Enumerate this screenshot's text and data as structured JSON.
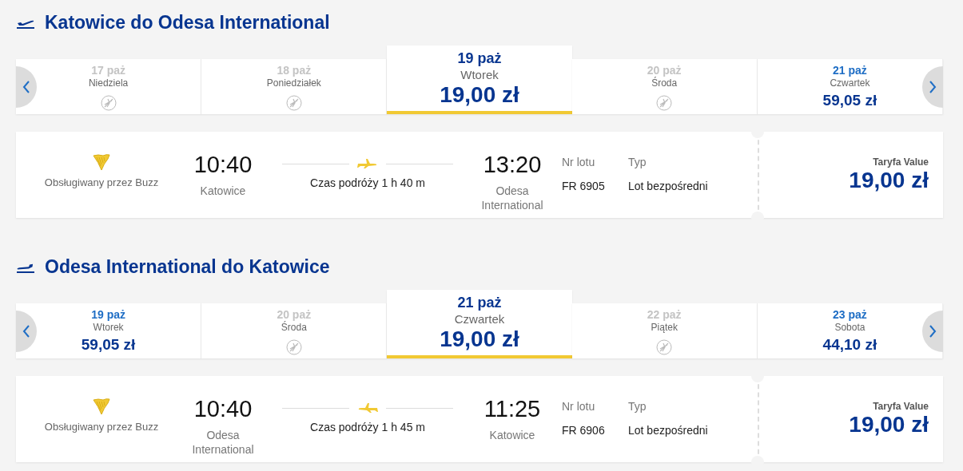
{
  "sections": [
    {
      "kind": "outbound",
      "title": "Katowice do Odesa International",
      "days": [
        {
          "date": "17 paż",
          "weekday": "Niedziela",
          "available": false,
          "selected": false
        },
        {
          "date": "18 paż",
          "weekday": "Poniedziałek",
          "available": false,
          "selected": false
        },
        {
          "date": "19 paż",
          "weekday": "Wtorek",
          "price": "19,00 zł",
          "available": true,
          "selected": true
        },
        {
          "date": "20 paż",
          "weekday": "Środa",
          "available": false,
          "selected": false
        },
        {
          "date": "21 paż",
          "weekday": "Czwartek",
          "price": "59,05 zł",
          "available": true,
          "selected": false
        }
      ],
      "flight": {
        "operator": "Obsługiwany przez Buzz",
        "departure_time": "10:40",
        "departure_city": "Katowice",
        "duration": "Czas podróży 1 h 40 m",
        "arrival_time": "13:20",
        "arrival_city": "Odesa International",
        "flight_number_label": "Nr lotu",
        "flight_number": "FR 6905",
        "type_label": "Typ",
        "type": "Lot bezpośredni",
        "fare_label": "Taryfa Value",
        "fare_price": "19,00 zł"
      }
    },
    {
      "kind": "return",
      "title": "Odesa International do Katowice",
      "days": [
        {
          "date": "19 paż",
          "weekday": "Wtorek",
          "price": "59,05 zł",
          "available": true,
          "selected": false
        },
        {
          "date": "20 paż",
          "weekday": "Środa",
          "available": false,
          "selected": false
        },
        {
          "date": "21 paż",
          "weekday": "Czwartek",
          "price": "19,00 zł",
          "available": true,
          "selected": true
        },
        {
          "date": "22 paż",
          "weekday": "Piątek",
          "available": false,
          "selected": false
        },
        {
          "date": "23 paż",
          "weekday": "Sobota",
          "price": "44,10 zł",
          "available": true,
          "selected": false
        }
      ],
      "flight": {
        "operator": "Obsługiwany przez Buzz",
        "departure_time": "10:40",
        "departure_city": "Odesa International",
        "duration": "Czas podróży 1 h 45 m",
        "arrival_time": "11:25",
        "arrival_city": "Katowice",
        "flight_number_label": "Nr lotu",
        "flight_number": "FR 6906",
        "type_label": "Typ",
        "type": "Lot bezpośredni",
        "fare_label": "Taryfa Value",
        "fare_price": "19,00 zł"
      }
    }
  ]
}
